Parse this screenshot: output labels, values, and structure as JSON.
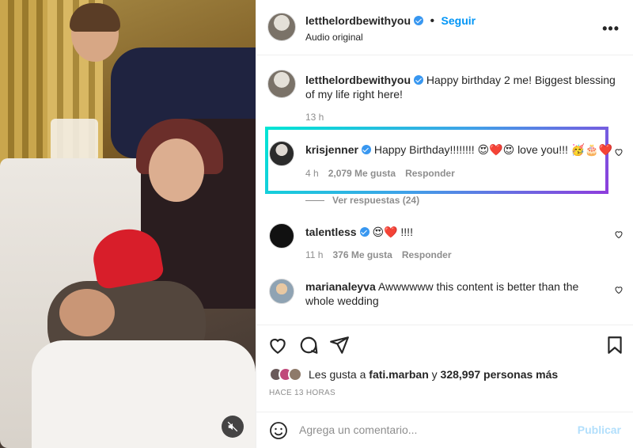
{
  "header": {
    "username": "letthelordbewithyou",
    "separator": "•",
    "follow_label": "Seguir",
    "audio_label": "Audio original",
    "more_icon": "more-horizontal-icon"
  },
  "caption": {
    "username": "letthelordbewithyou",
    "text": "Happy birthday 2 me! Biggest blessing of my life right here!",
    "time": "13 h"
  },
  "comments": [
    {
      "username": "krisjenner",
      "text": "Happy Birthday!!!!!!!! 😍❤️😍 love you!!! 🥳🎂❤️",
      "time": "4 h",
      "likes": "2,079 Me gusta",
      "reply": "Responder"
    },
    {
      "username": "talentless",
      "text": "😍❤️ !!!!",
      "time": "11 h",
      "likes": "376 Me gusta",
      "reply": "Responder"
    },
    {
      "username": "marianaleyva",
      "text": "Awwwwww this content is better than the whole wedding"
    }
  ],
  "view_replies": "Ver respuestas (24)",
  "actions": {
    "likes_prefix": "Les gusta a ",
    "likes_user": "fati.marban",
    "likes_middle": " y ",
    "likes_count": "328,997 personas más",
    "time_ago": "HACE 13 HORAS"
  },
  "comment_bar": {
    "placeholder": "Agrega un comentario...",
    "publish_label": "Publicar"
  },
  "colors": {
    "accent": "#0095f6",
    "verified": "#3897f0",
    "highlight_start": "#00e5d4",
    "highlight_end": "#8d3ddc"
  }
}
